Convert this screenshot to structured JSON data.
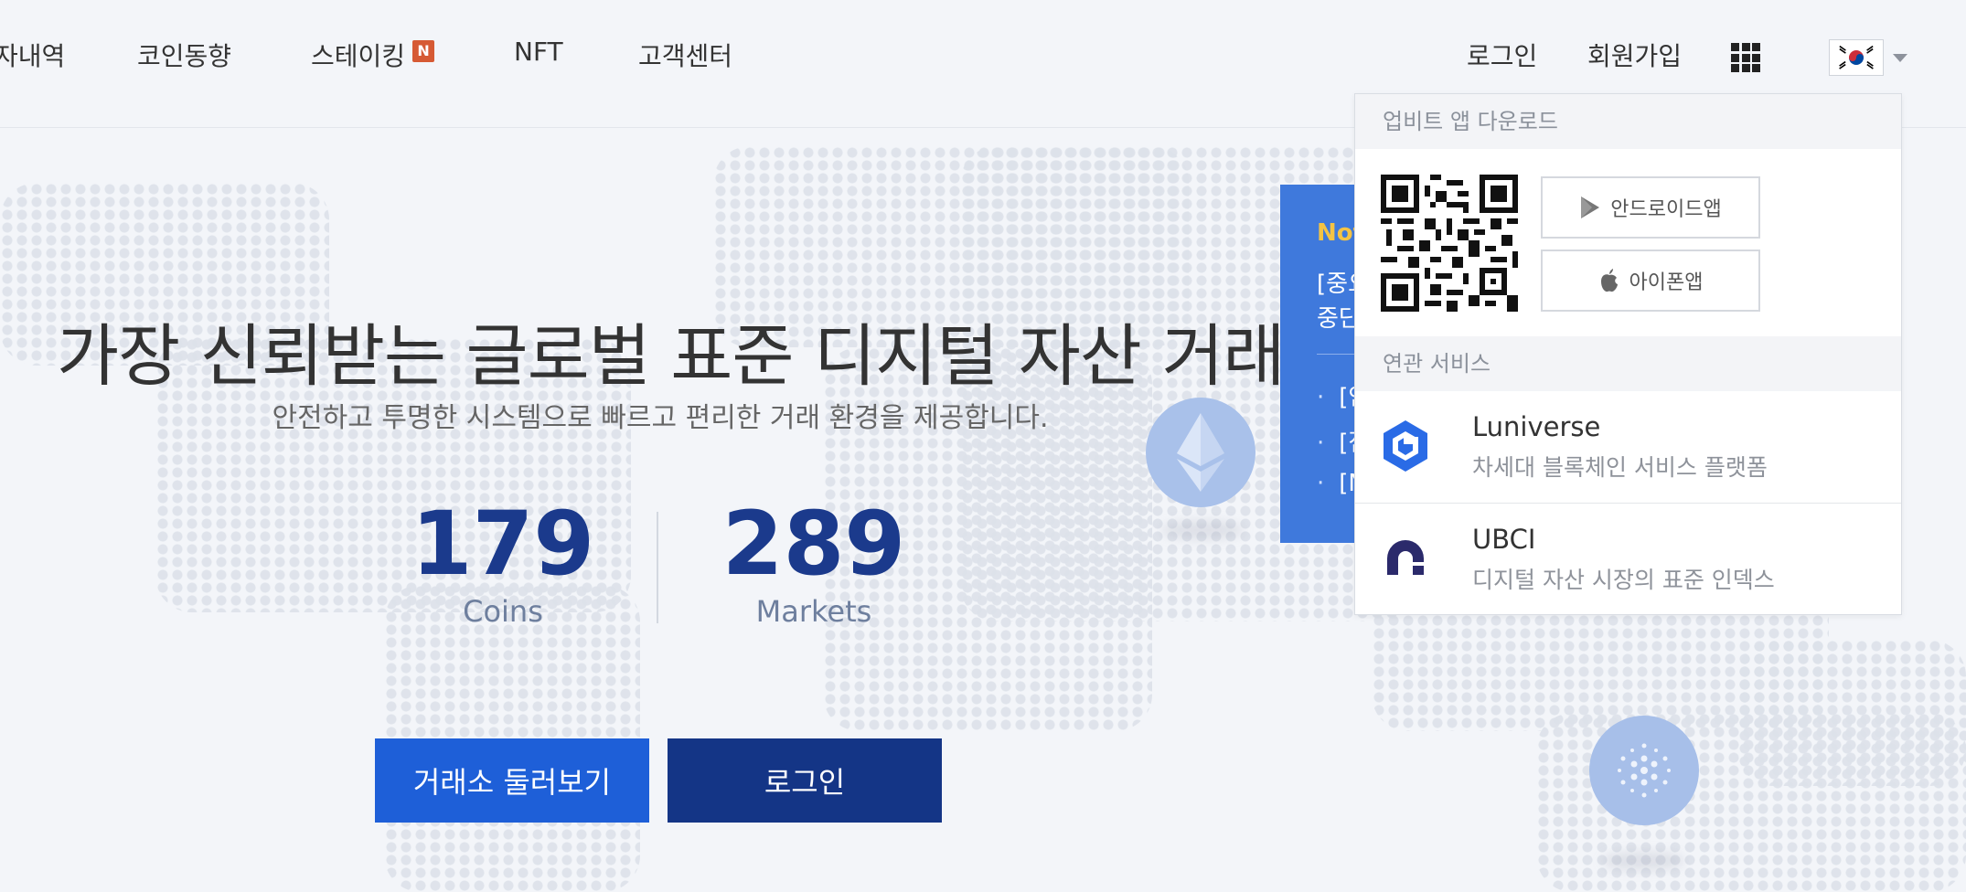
{
  "nav": {
    "items": [
      "자내역",
      "코인동향",
      "스테이킹",
      "NFT",
      "고객센터"
    ],
    "staking_badge": "N",
    "login": "로그인",
    "signup": "회원가입"
  },
  "hero": {
    "title": "가장 신뢰받는 글로벌 표준 디지털 자산 거래소",
    "subtitle": "안전하고 투명한 시스템으로 빠르고 편리한 거래 환경을 제공합니다.",
    "coins_value": "179",
    "coins_label": "Coins",
    "markets_value": "289",
    "markets_label": "Markets",
    "explore_button": "거래소 둘러보기",
    "login_button": "로그인"
  },
  "notice": {
    "title": "Not",
    "headline_1": "[중요",
    "headline_2": "중단",
    "items": [
      "[안",
      "[점",
      "[N"
    ]
  },
  "dropdown": {
    "app_header": "업비트 앱 다운로드",
    "android_label": "안드로이드앱",
    "iphone_label": "아이폰앱",
    "services_header": "연관 서비스",
    "services": [
      {
        "name": "Luniverse",
        "desc": "차세대 블록체인 서비스 플랫폼"
      },
      {
        "name": "UBCI",
        "desc": "디지털 자산 시장의 표준 인덱스"
      }
    ]
  },
  "colors": {
    "primary_blue": "#1e5fd8",
    "navy": "#143586",
    "stat_number": "#1b3a8c",
    "notice_bg": "#3f79dc",
    "badge": "#d65a34"
  },
  "icons": [
    "apps-grid-icon",
    "korea-flag-icon",
    "caret-down-icon",
    "qr-code",
    "google-play-icon",
    "apple-icon",
    "luniverse-logo",
    "ubci-logo",
    "ethereum-coin-icon",
    "cardano-coin-icon"
  ]
}
